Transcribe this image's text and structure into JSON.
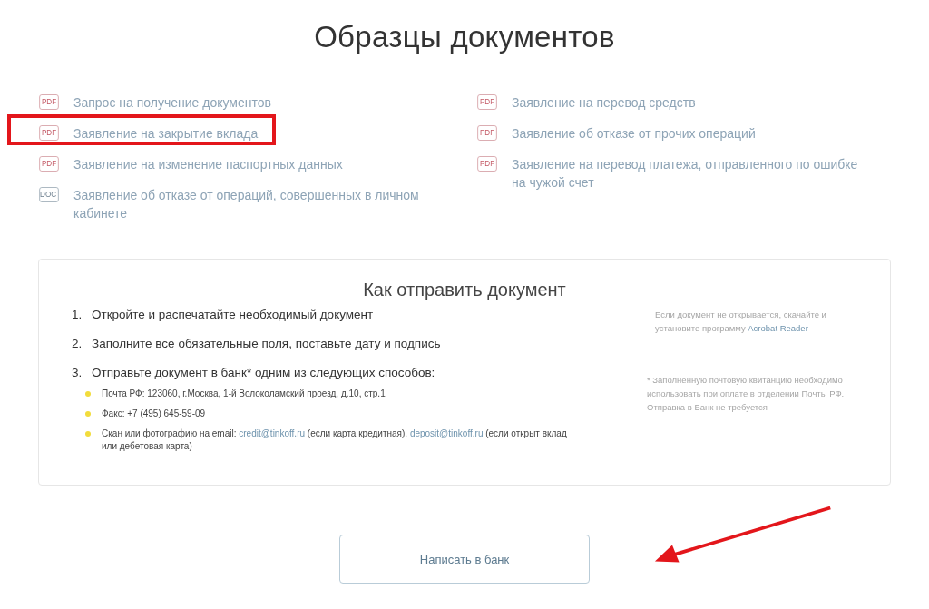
{
  "page_title": "Образцы документов",
  "documents": {
    "left": [
      {
        "format": "PDF",
        "kind": "pdf",
        "title": "Запрос на получение документов",
        "highlighted": false
      },
      {
        "format": "PDF",
        "kind": "pdf",
        "title": "Заявление на закрытие вклада",
        "highlighted": true
      },
      {
        "format": "PDF",
        "kind": "pdf",
        "title": "Заявление на изменение паспортных данных",
        "highlighted": false
      },
      {
        "format": "DOC",
        "kind": "doc",
        "title": "Заявление об отказе от операций, совершенных в личном кабинете",
        "highlighted": false
      }
    ],
    "right": [
      {
        "format": "PDF",
        "kind": "pdf",
        "title": "Заявление на перевод средств",
        "highlighted": false
      },
      {
        "format": "PDF",
        "kind": "pdf",
        "title": "Заявление об отказе от прочих операций",
        "highlighted": false
      },
      {
        "format": "PDF",
        "kind": "pdf",
        "title": "Заявление на перевод платежа, отправленного по ошибке на чужой счет",
        "highlighted": false
      }
    ]
  },
  "instructions": {
    "title": "Как отправить документ",
    "steps": [
      {
        "number": "1.",
        "text": "Откройте и распечатайте необходимый документ"
      },
      {
        "number": "2.",
        "text": "Заполните все обязательные поля, поставьте дату и подпись"
      },
      {
        "number": "3.",
        "text": "Отправьте документ в банк* одним из следующих способов:"
      }
    ],
    "methods": [
      [
        {
          "text": "Почта РФ: 123060, г.Москва, 1-й Волоколамский проезд, д.10, стр.1",
          "link": false
        }
      ],
      [
        {
          "text": "Факс: +7 (495) 645-59-09",
          "link": false
        }
      ],
      [
        {
          "text": "Скан или фотографию на email: ",
          "link": false
        },
        {
          "text": "credit@tinkoff.ru",
          "link": true
        },
        {
          "text": " (если карта кредитная), ",
          "link": false
        },
        {
          "text": "deposit@tinkoff.ru",
          "link": true
        },
        {
          "text": " (если открыт вклад или дебетовая карта)",
          "link": false
        }
      ]
    ],
    "notes": [
      [
        {
          "text": "Если документ не открывается, скачайте и установите программу ",
          "link": false
        },
        {
          "text": "Acrobat Reader",
          "link": true
        }
      ],
      [
        {
          "text": "* Заполненную почтовую квитанцию необходимо использовать при оплате в отделении Почты РФ. Отправка в Банк не требуется",
          "link": false
        }
      ]
    ]
  },
  "write_button": "Написать в банк"
}
